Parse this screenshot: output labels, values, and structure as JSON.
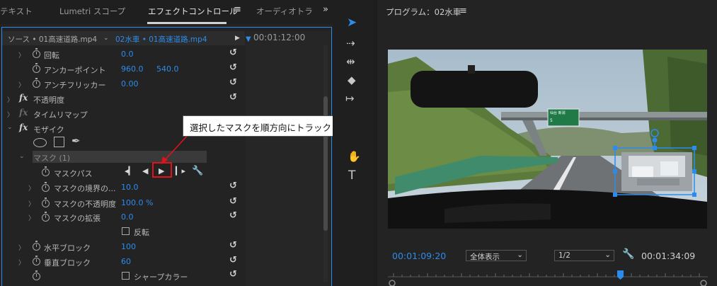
{
  "tabs": [
    "テキスト",
    "Lumetri スコープ",
    "エフェクトコントロール",
    "オーディオトラ"
  ],
  "active_tab_menu": "≡",
  "overflow": "»",
  "source": {
    "source_label": "ソース • 01高速道路.mp4",
    "sequence_label": "02水車 • 01高速道路.mp4",
    "timecode": "00:01:12:00"
  },
  "properties": {
    "rotation": {
      "label": "回転",
      "value": "0.0"
    },
    "anchor": {
      "label": "アンカーポイント",
      "x": "960.0",
      "y": "540.0"
    },
    "flicker": {
      "label": "アンチフリッカー",
      "value": "0.00"
    },
    "opacity_label": "不透明度",
    "timeremap_label": "タイムリマップ",
    "mosaic_label": "モザイク",
    "mask_label": "マスク (1)",
    "mask_path_label": "マスクパス",
    "mask_feather": {
      "label": "マスクの境界の...",
      "value": "10.0"
    },
    "mask_opacity": {
      "label": "マスクの不透明度",
      "value": "100.0 %"
    },
    "mask_expansion": {
      "label": "マスクの拡張",
      "value": "0.0"
    },
    "inverted_label": "反転",
    "horiz_blocks": {
      "label": "水平ブロック",
      "value": "100"
    },
    "vert_blocks": {
      "label": "垂直ブロック",
      "value": "60"
    },
    "sharp_label": "シャープカラー"
  },
  "callout": "選択したマスクを順方向にトラック",
  "monitor": {
    "title": "プログラム：02水車",
    "menu": "≡",
    "current_tc": "00:01:09:20",
    "fit": "全体表示",
    "resolution": "1/2",
    "duration": "00:01:34:09",
    "sign_text": "仙台 新潟",
    "sign_num": "5"
  },
  "colors": {
    "accent": "#2d8ceb",
    "highlight": "#e0121b"
  }
}
